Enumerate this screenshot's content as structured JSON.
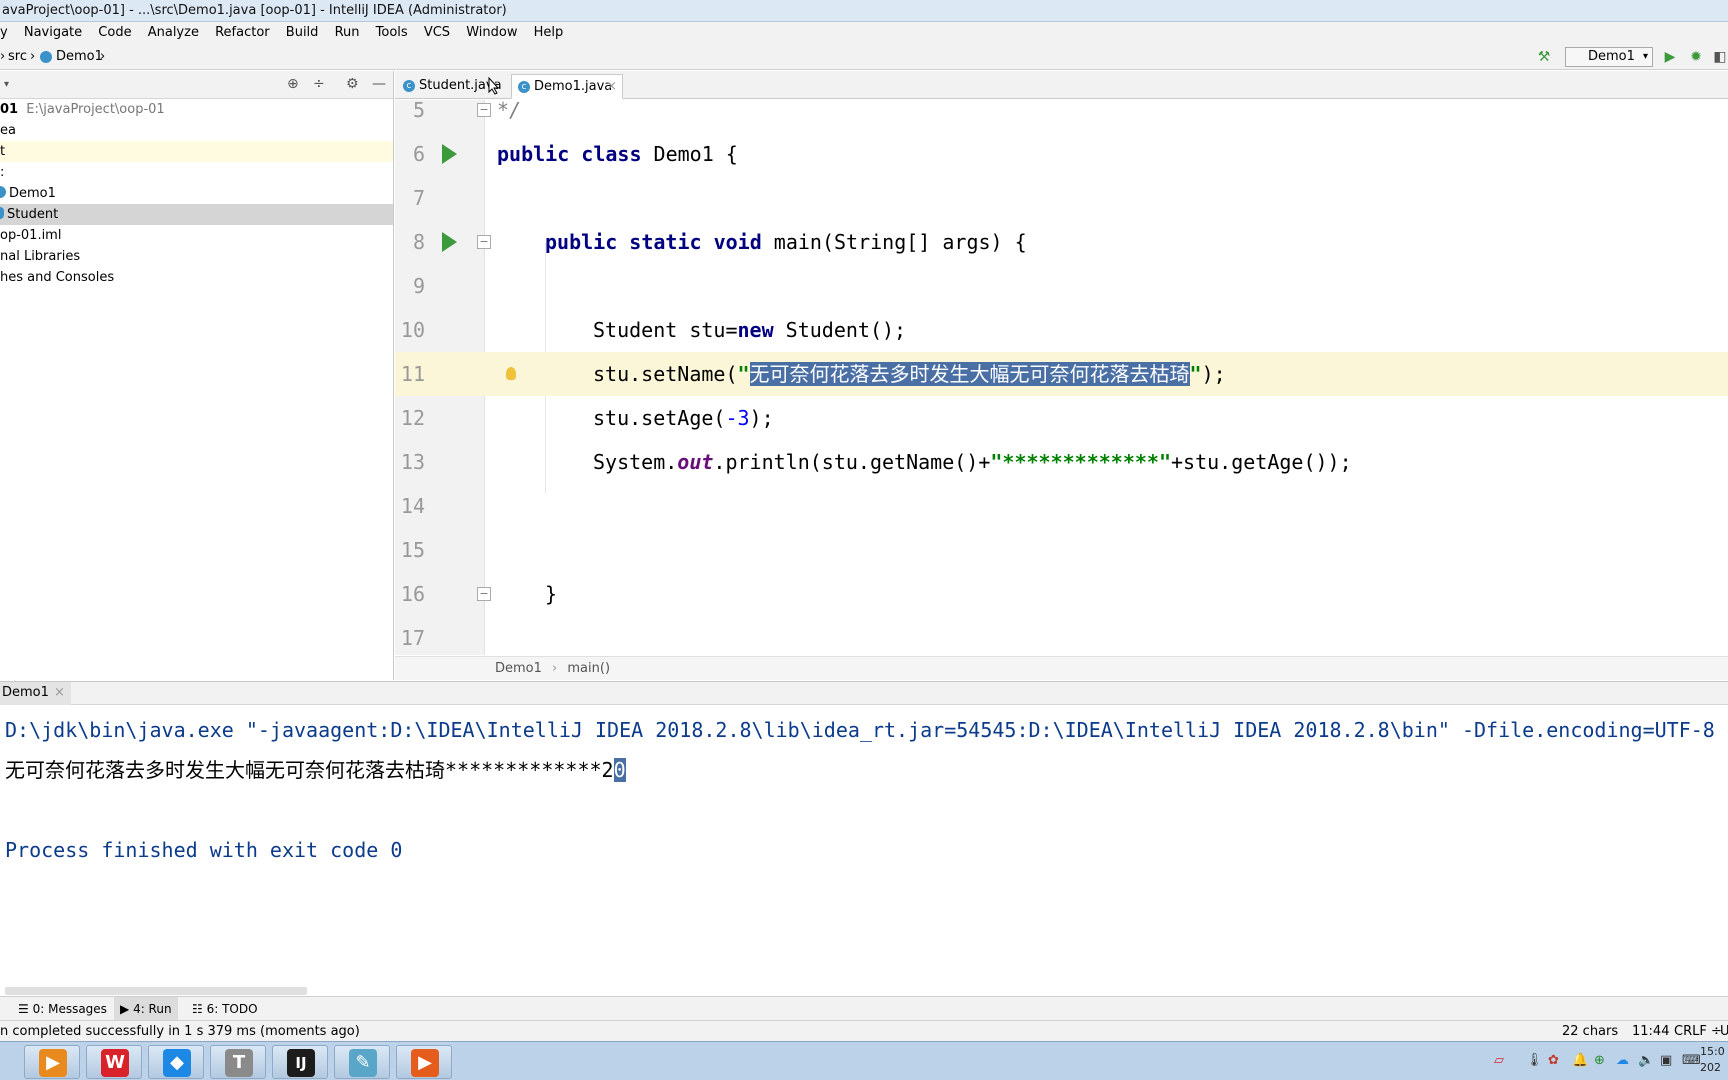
{
  "window": {
    "title": "avaProject\\oop-01] - ...\\src\\Demo1.java [oop-01] - IntelliJ IDEA (Administrator)"
  },
  "menu": [
    "y",
    "Navigate",
    "Code",
    "Analyze",
    "Refactor",
    "Build",
    "Run",
    "Tools",
    "VCS",
    "Window",
    "Help"
  ],
  "breadcrumb": {
    "src": "src",
    "file": "Demo1"
  },
  "run_config": {
    "selected": "Demo1"
  },
  "project_tree": {
    "root_name": "01",
    "root_path": "E:\\javaProject\\oop-01",
    "items": [
      "ea",
      "t",
      ":",
      "Demo1",
      "Student",
      "op-01.iml",
      "nal Libraries",
      "hes and Consoles"
    ]
  },
  "tabs": [
    {
      "label": "Student.java",
      "icon": "class-icon"
    },
    {
      "label": "Demo1.java",
      "icon": "class-icon"
    }
  ],
  "editor": {
    "line_numbers": [
      "5",
      "6",
      "7",
      "8",
      "9",
      "10",
      "11",
      "12",
      "13",
      "14",
      "15",
      "16",
      "17"
    ],
    "l5_comment": "*/",
    "l6_kw1": "public",
    "l6_kw2": "class",
    "l6_rest": " Demo1 {",
    "l8_kw": "public static void",
    "l8_rest": " main(String[] args) {",
    "l10_a": "Student stu=",
    "l10_kw": "new",
    "l10_b": " Student();",
    "l11_a": "stu.setName(",
    "l11_q1": "\"",
    "l11_str": "无可奈何花落去多时发生大幅无可奈何花落去枯琦",
    "l11_q2": "\"",
    "l11_b": ");",
    "l12_a": "stu.setAge(",
    "l12_num": "-3",
    "l12_b": ");",
    "l13_a": "System.",
    "l13_fld": "out",
    "l13_b": ".println(stu.getName()+",
    "l13_str": "\"*************\"",
    "l13_c": "+stu.getAge());",
    "l16_brace": "}"
  },
  "editor_breadcrumb": {
    "cls": "Demo1",
    "sep": "›",
    "method": "main()"
  },
  "run_tab": {
    "label": "Demo1"
  },
  "console": {
    "cmd": "D:\\jdk\\bin\\java.exe \"-javaagent:D:\\IDEA\\IntelliJ IDEA 2018.2.8\\lib\\idea_rt.jar=54545:D:\\IDEA\\IntelliJ IDEA 2018.2.8\\bin\" -Dfile.encoding=UTF-8 -",
    "output_text": "无可奈何花落去多时发生大幅无可奈何花落去枯琦*************2",
    "output_sel": "0",
    "exit": "Process finished with exit code 0"
  },
  "tool_tabs": [
    {
      "label": "0: Messages"
    },
    {
      "label": "4: Run"
    },
    {
      "label": "6: TODO"
    }
  ],
  "status": {
    "message": "n completed successfully in 1 s 379 ms (moments ago)",
    "chars": "22 chars",
    "position": "11:44",
    "line_sep": "CRLF ÷",
    "encoding": "U"
  },
  "taskbar": {
    "apps": [
      {
        "name": "video-player",
        "glyph": "▶",
        "color": "#e98a1f"
      },
      {
        "name": "wps",
        "glyph": "W",
        "color": "#d8232a"
      },
      {
        "name": "feishu",
        "glyph": "◆",
        "color": "#1e88e5"
      },
      {
        "name": "typora",
        "glyph": "T",
        "color": "#8a8a8a"
      },
      {
        "name": "intellij",
        "glyph": "IJ",
        "color": "#1c1c1c"
      },
      {
        "name": "notes",
        "glyph": "✎",
        "color": "#5aa6c8"
      },
      {
        "name": "slides",
        "glyph": "▶",
        "color": "#e45d1c"
      }
    ],
    "clock_time": "15:0",
    "clock_date": "202"
  }
}
